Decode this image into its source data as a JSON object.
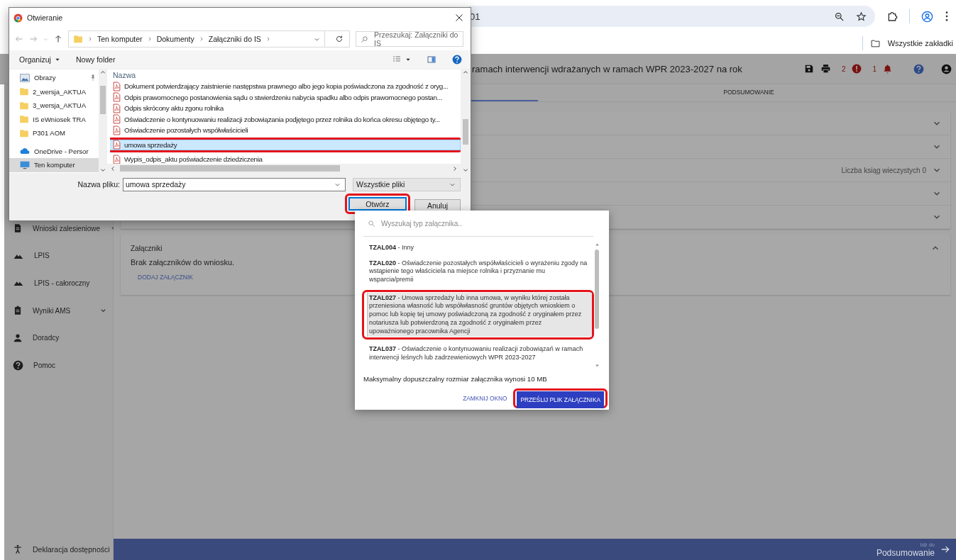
{
  "browser": {
    "address_text": "01",
    "bookmarks_label": "Wszystkie zakładki"
  },
  "header": {
    "title": "ramach interwencji wdrażanych w ramach WPR 2023-2027 na rok",
    "error_count": "2",
    "notification_count": "1"
  },
  "tabs": [
    {
      "label": "PODSUMOWANIE",
      "selected": false
    }
  ],
  "sections": [
    {
      "expanded": false
    },
    {
      "expanded": false
    },
    {
      "expanded": false,
      "summary": "Liczba ksiąg wieczystych 0"
    },
    {
      "expanded": false
    },
    {
      "expanded": false
    }
  ],
  "attachments": {
    "expanded": true,
    "title": "Załączniki",
    "empty_text": "Brak załączników do wniosku.",
    "add_label": "DODAJ ZAŁĄCZNIK"
  },
  "sidebar": {
    "items": [
      {
        "kind": "document",
        "label": "Wnioski zalesieniowe",
        "expandable": true
      },
      {
        "kind": "terrain",
        "label": "LPIS",
        "expandable": false
      },
      {
        "kind": "terrain",
        "label": "LPIS - całoroczny",
        "expandable": false
      },
      {
        "kind": "clipboard",
        "label": "Wyniki AMS",
        "expandable": true
      },
      {
        "kind": "person",
        "label": "Doradcy",
        "expandable": false
      },
      {
        "kind": "help",
        "label": "Pomoc",
        "expandable": false
      }
    ],
    "footer": "Deklaracja dostępności"
  },
  "next_bar": {
    "caption": "Idź do",
    "label": "Podsumowanie"
  },
  "file_dialog": {
    "title": "Otwieranie",
    "path": [
      "Ten komputer",
      "Dokumenty",
      "Załączniki do IS"
    ],
    "search_placeholder": "Przeszukaj: Załączniki do IS",
    "organize": "Organizuj",
    "new_folder": "Nowy folder",
    "nav_items": [
      {
        "kind": "pictures",
        "label": "Obrazy",
        "pinned": true,
        "selected": false
      },
      {
        "kind": "folder",
        "label": "2_wersja_AKTUA",
        "pinned": false,
        "selected": false
      },
      {
        "kind": "folder",
        "label": "3_wersja_AKTUA",
        "pinned": false,
        "selected": false
      },
      {
        "kind": "folder",
        "label": "IS eWniosek TRA",
        "pinned": false,
        "selected": false
      },
      {
        "kind": "folder",
        "label": "P301 AOM",
        "pinned": false,
        "selected": false
      },
      {
        "kind": "cloud",
        "label": "OneDrive - Persor",
        "pinned": false,
        "selected": false
      },
      {
        "kind": "computer",
        "label": "Ten komputer",
        "pinned": false,
        "selected": true
      }
    ],
    "column": "Nazwa",
    "files": [
      {
        "name": "Dokument potwierdzający zaistnienie następstwa prawnego albo jego kopia poświadczona za zgodność z oryg...",
        "selected": false
      },
      {
        "name": "Odpis prawomocnego postanowienia sądu o stwierdzeniu nabycia spadku albo odpis prawomocnego postan...",
        "selected": false
      },
      {
        "name": "Odpis skrócony aktu zgonu rolnika",
        "selected": false
      },
      {
        "name": "Oświadczenie o kontynuowaniu realizacji zobowiązania podjętego przez rolnika do końca okresu objętego ty...",
        "selected": false
      },
      {
        "name": "Oświadczenie pozostałych współwłaścicieli",
        "selected": false
      },
      {
        "name": "umowa sprzedaży",
        "selected": true
      },
      {
        "name": "Wypis_odpis_aktu poświadczenie dziedziczenia",
        "selected": false
      }
    ],
    "filename_label": "Nazwa pliku:",
    "filename": "umowa sprzedaży",
    "filter": "Wszystkie pliki",
    "buttons": [
      {
        "kind": "primary",
        "label": "Otwórz"
      },
      {
        "kind": "secondary",
        "label": "Anuluj"
      }
    ]
  },
  "upload_dialog": {
    "search_placeholder": "Wyszukaj typ załącznika..",
    "options": [
      {
        "text": "**TZAL004** - Inny",
        "selected": false
      },
      {
        "text": "**TZAL020** - Oświadczenie pozostałych współwłaścicieli o wyrażeniu zgody na wstąpienie tego właściciela na miejsce rolnika i przyznanie mu wsparcia/premii",
        "selected": false
      },
      {
        "text": "**TZAL027** - Umowa sprzedaży lub inna umowa, w wyniku której została przeniesiona własność lub współwłasność gruntów objętych wnioskiem o pomoc lub kopię tej umowy poświadczoną za zgodność z oryginałem przez notariusza lub potwierdzoną za zgodność z oryginałem przez upoważnionego pracownika Agencji",
        "selected": true
      },
      {
        "text": "**TZAL037** - Oświadczenie o kontynuowaniu realizacji zobowiązań w ramach interwencji leśnych lub zadrzewieniowych WPR 2023-2027",
        "selected": false
      }
    ],
    "info": "Maksymalny dopuszczalny rozmiar załącznika wynosi 10 MB",
    "buttons": [
      {
        "kind": "text",
        "label": "ZAMKNIJ OKNO"
      },
      {
        "kind": "primary",
        "label": "PRZEŚLIJ PLIK ZAŁĄCZNIKA"
      }
    ]
  }
}
